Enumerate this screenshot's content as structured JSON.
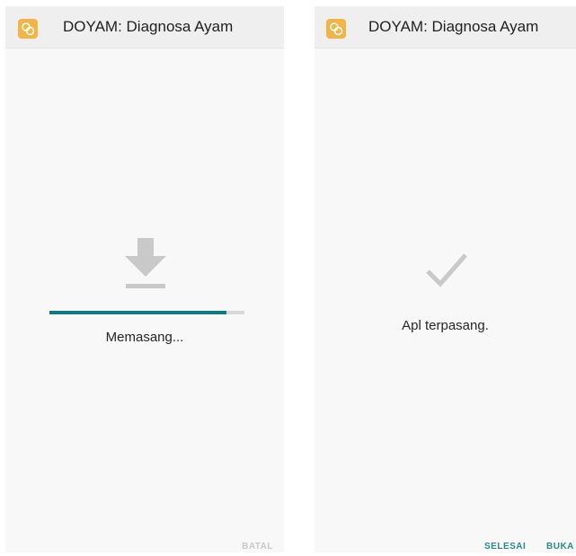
{
  "left_screen": {
    "app_title": "DOYAM: Diagnosa Ayam",
    "status": "Memasang...",
    "progress": 0.91,
    "cancel_label": "BATAL",
    "icon": "download-icon"
  },
  "right_screen": {
    "app_title": "DOYAM: Diagnosa Ayam",
    "status": "Apl terpasang.",
    "done_label": "SELESAI",
    "open_label": "BUKA",
    "icon": "check-icon"
  },
  "colors": {
    "accent": "#0f7a7f",
    "button_text": "#2a8a87",
    "app_icon": "#f2b545",
    "disabled": "#c8c8c8"
  }
}
